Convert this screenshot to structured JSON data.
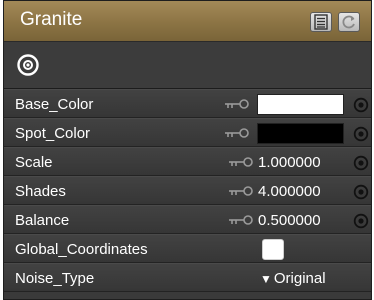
{
  "panel": {
    "title": "Granite",
    "header_buttons": [
      "list-view-icon",
      "refresh-icon"
    ]
  },
  "toolbar": {
    "icon": "target-icon"
  },
  "parameters": [
    {
      "label": "Base_Color",
      "type": "color",
      "color": "#ffffff"
    },
    {
      "label": "Spot_Color",
      "type": "color",
      "color": "#000000"
    },
    {
      "label": "Scale",
      "type": "number",
      "value": "1.000000"
    },
    {
      "label": "Shades",
      "type": "number",
      "value": "4.000000"
    },
    {
      "label": "Balance",
      "type": "number",
      "value": "0.500000"
    },
    {
      "label": "Global_Coordinates",
      "type": "checkbox",
      "checked": false
    },
    {
      "label": "Noise_Type",
      "type": "dropdown",
      "value": "Original",
      "arrow": "▼"
    }
  ]
}
